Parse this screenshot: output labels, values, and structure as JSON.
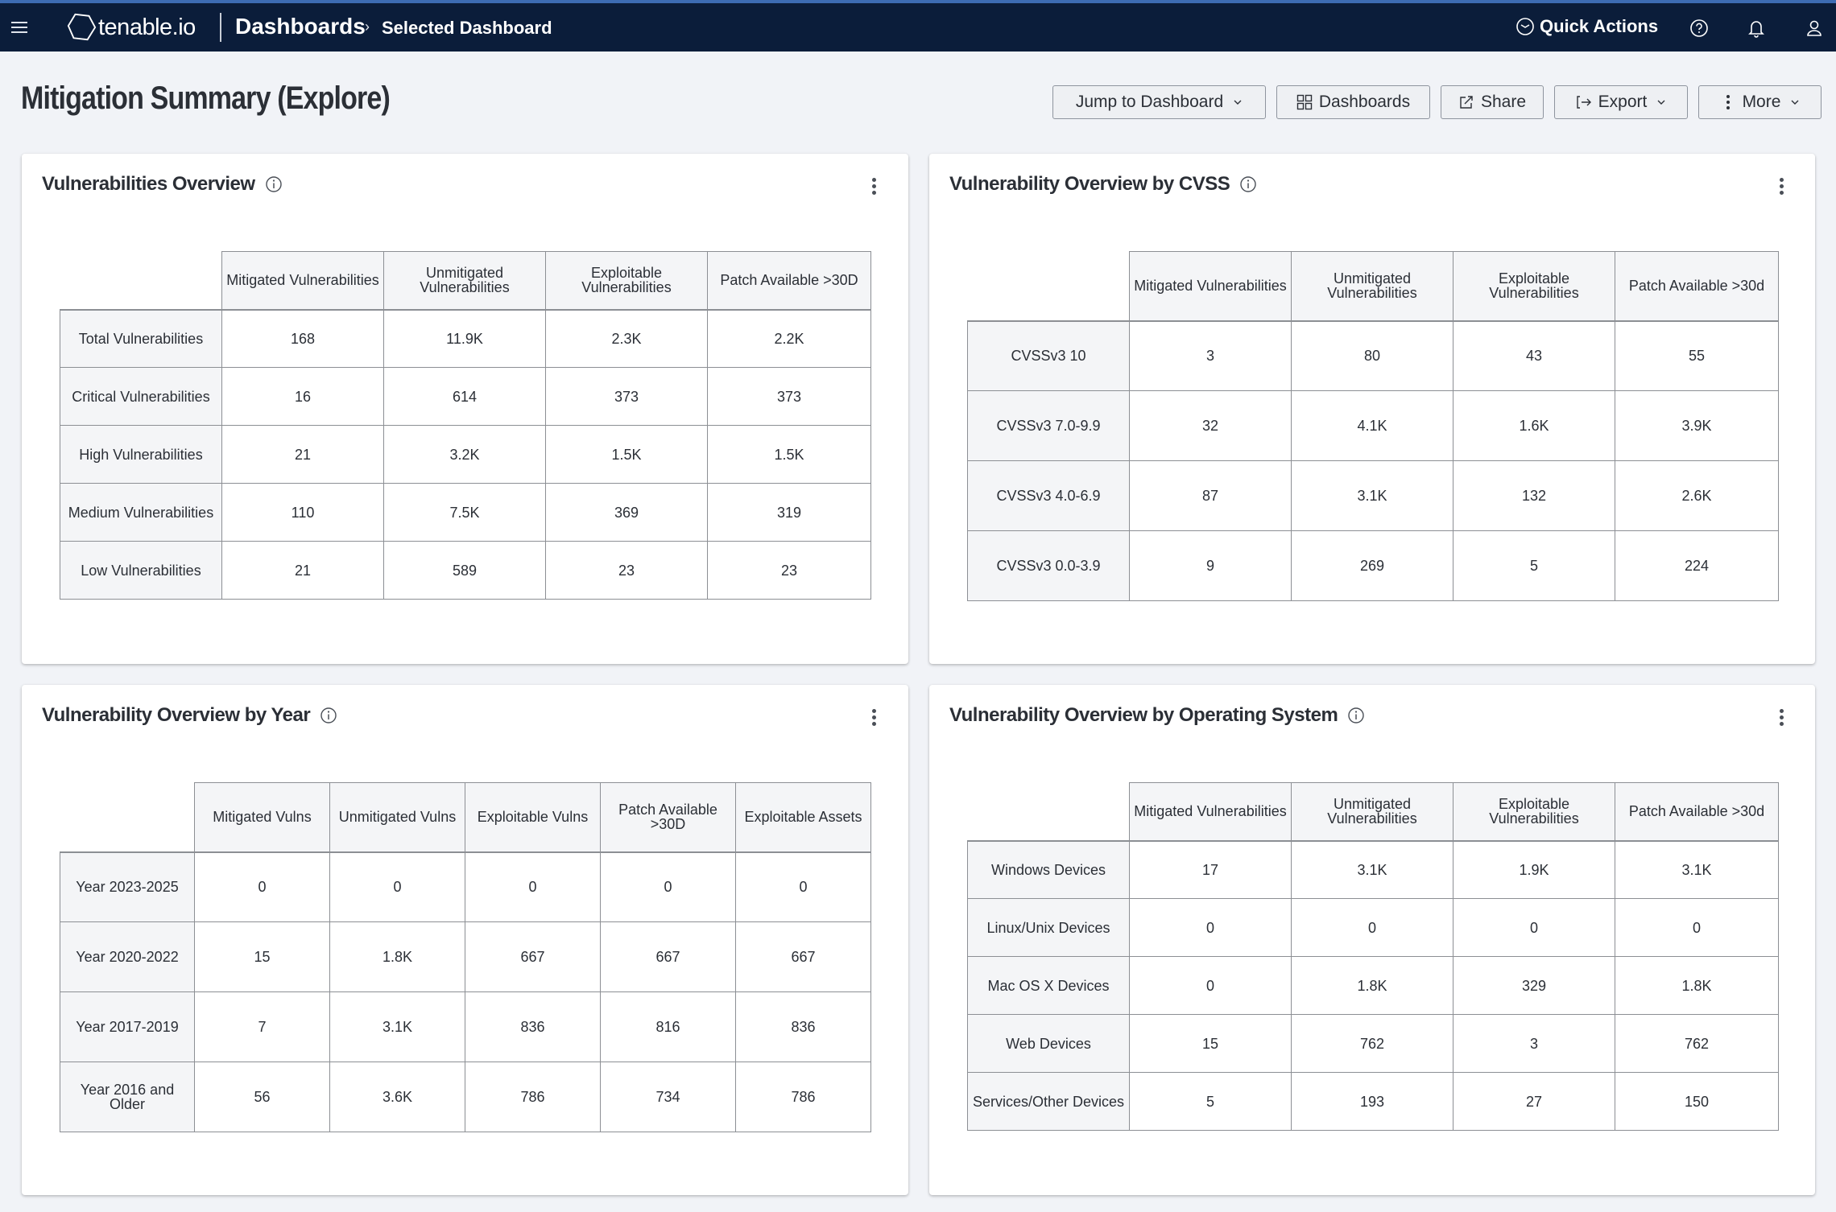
{
  "nav": {
    "menu_icon": "hamburger-icon",
    "logo_text": "tenable.io",
    "breadcrumb_main": "Dashboards",
    "breadcrumb_sep": "›",
    "breadcrumb_sub": "Selected Dashboard",
    "quick_actions_label": "Quick Actions",
    "icons": [
      "clock-icon",
      "help-icon",
      "bell-icon",
      "user-icon"
    ]
  },
  "page": {
    "title": "Mitigation Summary (Explore)"
  },
  "toolbar": {
    "jump_label": "Jump to Dashboard",
    "dashboards_label": "Dashboards",
    "share_label": "Share",
    "export_label": "Export",
    "more_label": "More"
  },
  "colors": {
    "nav_bg": "#0b1d3a",
    "nav_accent": "#3d6cb3",
    "page_bg": "#f1f3f7",
    "header_cell_bg": "#f4f5f7"
  },
  "panels": {
    "overview": {
      "title": "Vulnerabilities Overview",
      "columns": [
        "Mitigated Vulnerabilities",
        "Unmitigated Vulnerabilities",
        "Exploitable Vulnerabilities",
        "Patch Available >30D"
      ],
      "rows": [
        {
          "label": "Total Vulnerabilities",
          "values": [
            "168",
            "11.9K",
            "2.3K",
            "2.2K"
          ]
        },
        {
          "label": "Critical Vulnerabilities",
          "values": [
            "16",
            "614",
            "373",
            "373"
          ]
        },
        {
          "label": "High Vulnerabilities",
          "values": [
            "21",
            "3.2K",
            "1.5K",
            "1.5K"
          ]
        },
        {
          "label": "Medium Vulnerabilities",
          "values": [
            "110",
            "7.5K",
            "369",
            "319"
          ]
        },
        {
          "label": "Low Vulnerabilities",
          "values": [
            "21",
            "589",
            "23",
            "23"
          ]
        }
      ]
    },
    "cvss": {
      "title": "Vulnerability Overview by CVSS",
      "columns": [
        "Mitigated Vulnerabilities",
        "Unmitigated Vulnerabilities",
        "Exploitable Vulnerabilities",
        "Patch Available >30d"
      ],
      "rows": [
        {
          "label": "CVSSv3 10",
          "values": [
            "3",
            "80",
            "43",
            "55"
          ]
        },
        {
          "label": "CVSSv3 7.0-9.9",
          "values": [
            "32",
            "4.1K",
            "1.6K",
            "3.9K"
          ]
        },
        {
          "label": "CVSSv3 4.0-6.9",
          "values": [
            "87",
            "3.1K",
            "132",
            "2.6K"
          ]
        },
        {
          "label": "CVSSv3 0.0-3.9",
          "values": [
            "9",
            "269",
            "5",
            "224"
          ]
        }
      ]
    },
    "year": {
      "title": "Vulnerability Overview by Year",
      "columns": [
        "Mitigated Vulns",
        "Unmitigated Vulns",
        "Exploitable Vulns",
        "Patch Available >30D",
        "Exploitable Assets"
      ],
      "rows": [
        {
          "label": "Year 2023-2025",
          "values": [
            "0",
            "0",
            "0",
            "0",
            "0"
          ]
        },
        {
          "label": "Year 2020-2022",
          "values": [
            "15",
            "1.8K",
            "667",
            "667",
            "667"
          ]
        },
        {
          "label": "Year 2017-2019",
          "values": [
            "7",
            "3.1K",
            "836",
            "816",
            "836"
          ]
        },
        {
          "label": "Year 2016 and Older",
          "values": [
            "56",
            "3.6K",
            "786",
            "734",
            "786"
          ]
        }
      ]
    },
    "os": {
      "title": "Vulnerability Overview by Operating System",
      "columns": [
        "Mitigated Vulnerabilities",
        "Unmitigated Vulnerabilities",
        "Exploitable Vulnerabilities",
        "Patch Available >30d"
      ],
      "rows": [
        {
          "label": "Windows Devices",
          "values": [
            "17",
            "3.1K",
            "1.9K",
            "3.1K"
          ]
        },
        {
          "label": "Linux/Unix Devices",
          "values": [
            "0",
            "0",
            "0",
            "0"
          ]
        },
        {
          "label": "Mac OS X Devices",
          "values": [
            "0",
            "1.8K",
            "329",
            "1.8K"
          ]
        },
        {
          "label": "Web Devices",
          "values": [
            "15",
            "762",
            "3",
            "762"
          ]
        },
        {
          "label": "Services/Other Devices",
          "values": [
            "5",
            "193",
            "27",
            "150"
          ]
        }
      ]
    }
  }
}
